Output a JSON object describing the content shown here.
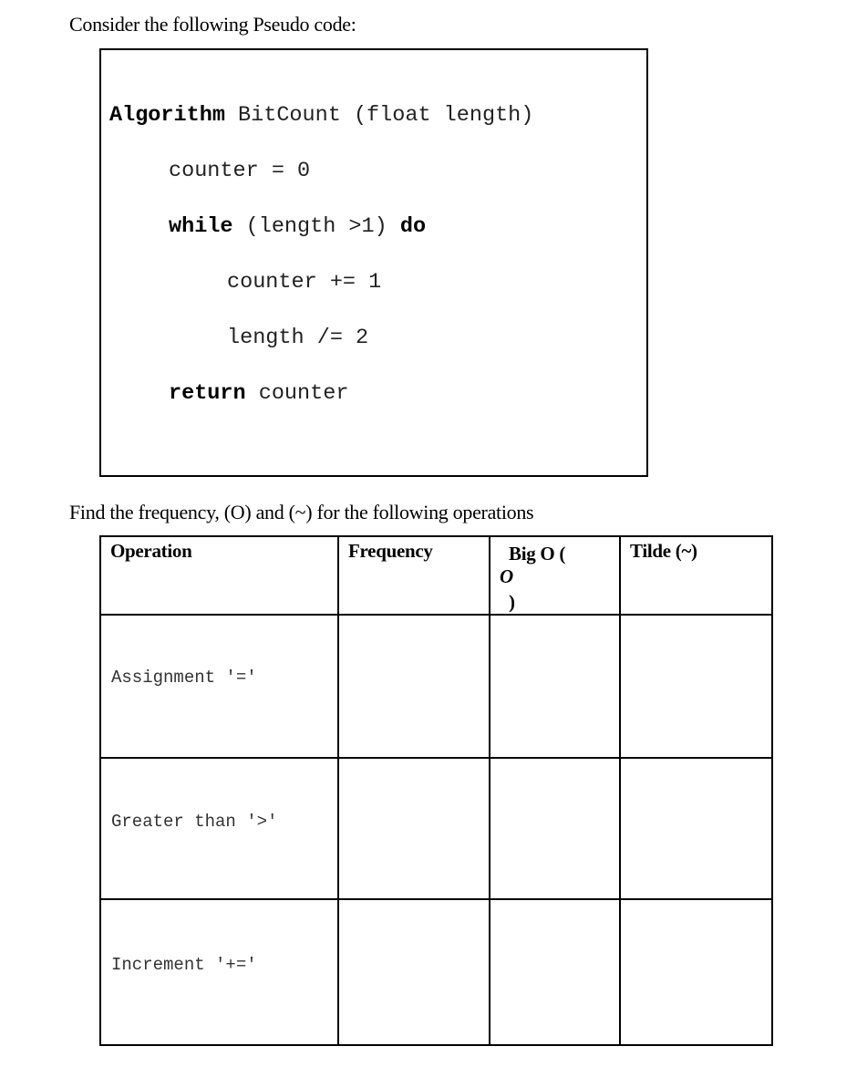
{
  "intro": "Consider the following Pseudo code:",
  "code": {
    "line1": {
      "kw": "Algorithm",
      "rest": " BitCount (float length)"
    },
    "line2": "counter = 0",
    "line3": {
      "kw": "while",
      "mid": " (length >1) ",
      "kw2": "do"
    },
    "line4": "counter += 1",
    "line5": "length /= 2",
    "line6": {
      "kw": "return",
      "rest": " counter"
    }
  },
  "instruction": "Find the frequency, (O) and (~) for the following operations",
  "table": {
    "headers": [
      "Operation",
      "Frequency",
      "Big O (",
      "O",
      ")",
      "Tilde (~)"
    ],
    "rows": [
      {
        "operation": "Assignment '='",
        "frequency": "",
        "big_o": "",
        "tilde": ""
      },
      {
        "operation": "Greater than '>'",
        "frequency": "",
        "big_o": "",
        "tilde": ""
      },
      {
        "operation": "Increment '+='",
        "frequency": "",
        "big_o": "",
        "tilde": ""
      }
    ]
  }
}
